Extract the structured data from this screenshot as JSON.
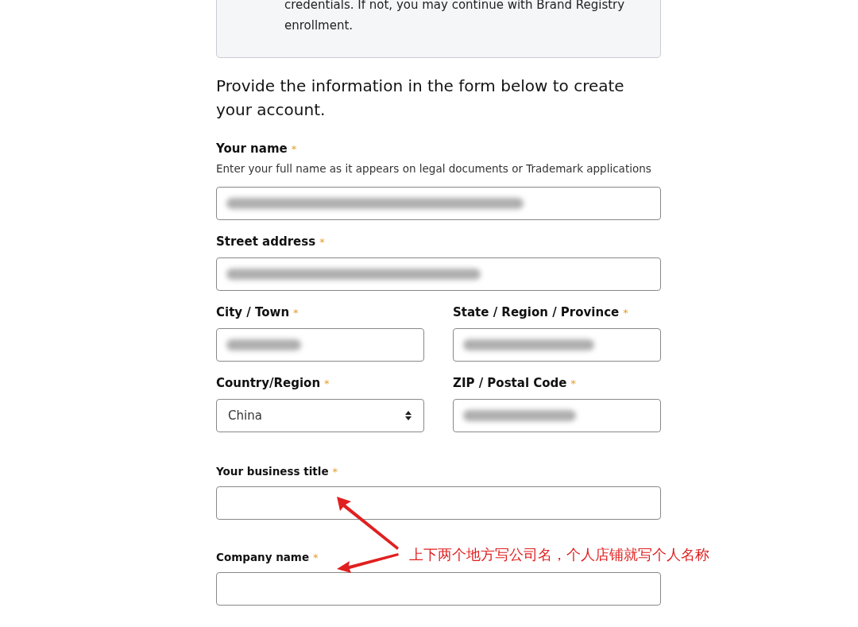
{
  "notice": {
    "text": "credentials. If not, you may continue with Brand Registry enrollment."
  },
  "heading": "Provide the information in the form below to create your account.",
  "rows": [
    {
      "kind": "primary",
      "fields": [
        {
          "label": "Your name",
          "required_mark": "*",
          "hint": "Enter your full name as it appears on legal documents or Trademark applications",
          "kind": "text",
          "filled": true
        }
      ]
    },
    {
      "kind": "primary",
      "fields": [
        {
          "label": "Street address",
          "required_mark": "*",
          "kind": "text",
          "filled": true
        }
      ]
    },
    {
      "kind": "primary",
      "fields": [
        {
          "label": "City / Town",
          "required_mark": "*",
          "kind": "text",
          "filled": true
        },
        {
          "label": "State / Region / Province",
          "required_mark": "*",
          "kind": "text",
          "filled": true
        }
      ]
    },
    {
      "kind": "primary",
      "fields": [
        {
          "label": "Country/Region",
          "required_mark": "*",
          "kind": "select",
          "value": "China"
        },
        {
          "label": "ZIP / Postal Code",
          "required_mark": "*",
          "kind": "text",
          "filled": true
        }
      ]
    },
    {
      "kind": "secondary",
      "fields": [
        {
          "label": "Your business title",
          "required_mark": "*",
          "kind": "text",
          "filled": false
        }
      ]
    },
    {
      "kind": "secondary",
      "fields": [
        {
          "label": "Company name",
          "required_mark": "*",
          "kind": "text",
          "filled": false
        }
      ]
    }
  ],
  "annotation": {
    "text": "上下两个地方写公司名，个人店铺就写个人名称"
  }
}
